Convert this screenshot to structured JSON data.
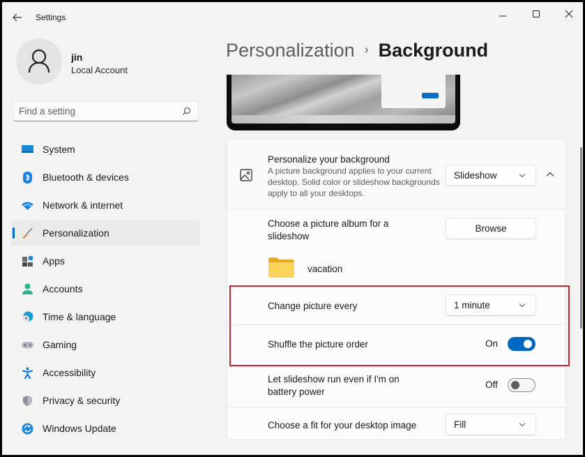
{
  "window": {
    "app_title": "Settings",
    "controls": {
      "minimize": "minimize-icon",
      "maximize": "maximize-icon",
      "close": "close-icon"
    }
  },
  "profile": {
    "name": "jin",
    "account_type": "Local Account"
  },
  "search": {
    "placeholder": "Find a setting",
    "value": ""
  },
  "sidebar": {
    "active_index": 3,
    "items": [
      {
        "label": "System",
        "icon": "system-icon"
      },
      {
        "label": "Bluetooth & devices",
        "icon": "bluetooth-icon"
      },
      {
        "label": "Network & internet",
        "icon": "wifi-icon"
      },
      {
        "label": "Personalization",
        "icon": "brush-icon"
      },
      {
        "label": "Apps",
        "icon": "apps-icon"
      },
      {
        "label": "Accounts",
        "icon": "accounts-icon"
      },
      {
        "label": "Time & language",
        "icon": "time-language-icon"
      },
      {
        "label": "Gaming",
        "icon": "gaming-icon"
      },
      {
        "label": "Accessibility",
        "icon": "accessibility-icon"
      },
      {
        "label": "Privacy & security",
        "icon": "shield-icon"
      },
      {
        "label": "Windows Update",
        "icon": "update-icon"
      }
    ]
  },
  "breadcrumb": {
    "parent": "Personalization",
    "separator": "›",
    "current": "Background"
  },
  "settings": {
    "personalize": {
      "title": "Personalize your background",
      "description": "A picture background applies to your current desktop. Solid color or slideshow backgrounds apply to all your desktops.",
      "value": "Slideshow"
    },
    "album": {
      "title": "Choose a picture album for a slideshow",
      "button": "Browse",
      "folder": "vacation"
    },
    "change_picture": {
      "title": "Change picture every",
      "value": "1 minute"
    },
    "shuffle": {
      "title": "Shuffle the picture order",
      "state_label": "On",
      "checked": true
    },
    "battery": {
      "title": "Let slideshow run even if I'm on battery power",
      "state_label": "Off",
      "checked": false
    },
    "fit": {
      "title": "Choose a fit for your desktop image",
      "value": "Fill"
    }
  },
  "colors": {
    "accent": "#0067c0",
    "highlight_box": "#c8232c"
  }
}
